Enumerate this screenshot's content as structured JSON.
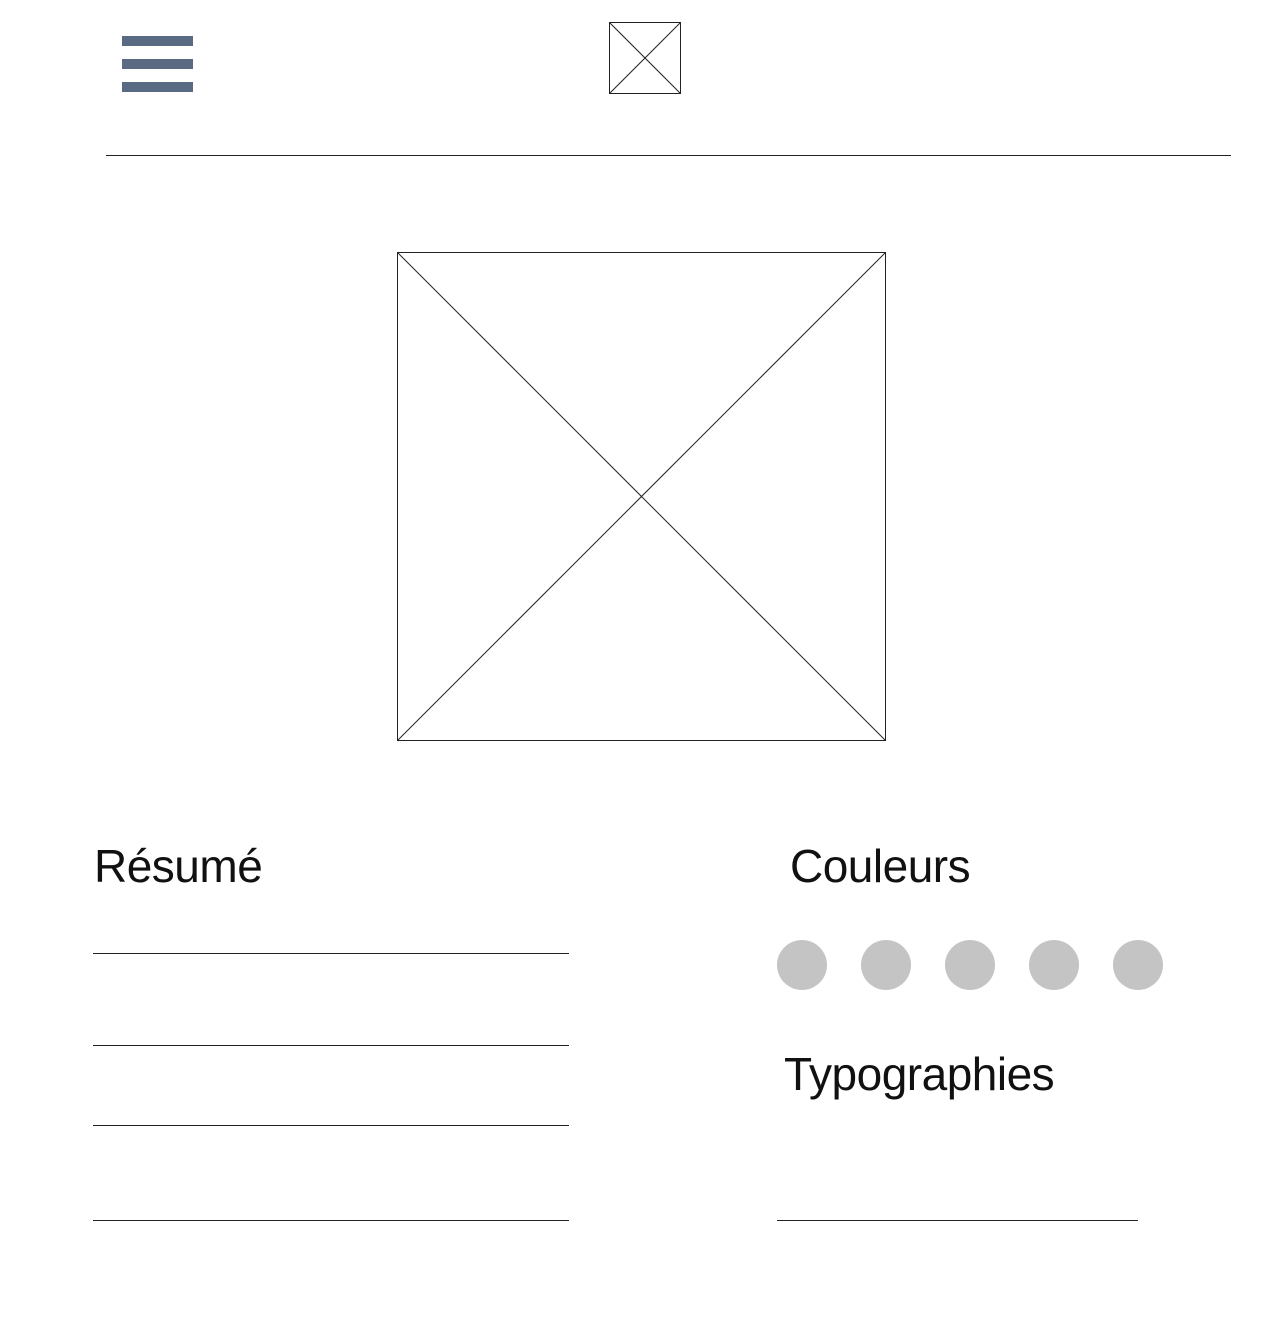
{
  "header": {
    "menu_icon": "hamburger-menu-icon",
    "menu_color": "#5a6a82",
    "logo_icon": "image-placeholder-icon"
  },
  "hero": {
    "image_icon": "image-placeholder-icon"
  },
  "resume": {
    "title": "Résumé"
  },
  "colors": {
    "title": "Couleurs",
    "swatches": [
      "#c4c4c4",
      "#c4c4c4",
      "#c4c4c4",
      "#c4c4c4",
      "#c4c4c4"
    ]
  },
  "typography": {
    "title": "Typographies"
  }
}
